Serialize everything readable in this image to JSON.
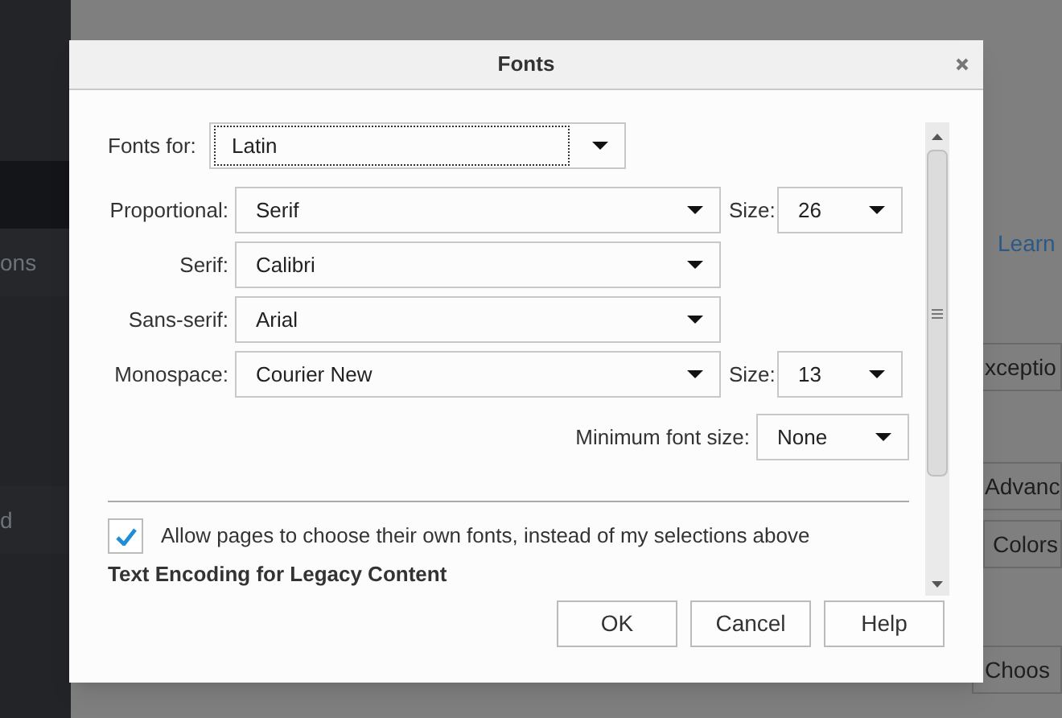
{
  "background": {
    "sidebar": {
      "items": [
        {
          "selected": true
        },
        {
          "label": "ons",
          "selected": false
        },
        {
          "label": "d",
          "selected": false
        }
      ]
    },
    "page": {
      "link": "Learn",
      "buttons": [
        "xceptio",
        "Advanc",
        "Colors",
        "Choos"
      ]
    }
  },
  "dialog": {
    "title": "Fonts",
    "fonts_for": {
      "label": "Fonts for:",
      "value": "Latin",
      "focused": true
    },
    "rows": [
      {
        "label": "Proportional:",
        "value": "Serif",
        "size": {
          "label": "Size:",
          "value": "26"
        }
      },
      {
        "label": "Serif:",
        "value": "Calibri"
      },
      {
        "label": "Sans-serif:",
        "value": "Arial"
      },
      {
        "label": "Monospace:",
        "value": "Courier New",
        "size": {
          "label": "Size:",
          "value": "13"
        }
      }
    ],
    "minimum": {
      "label": "Minimum font size:",
      "value": "None"
    },
    "allow": {
      "label": "Allow pages to choose their own fonts, instead of my selections above",
      "checked": true
    },
    "section_heading": "Text Encoding for Legacy Content",
    "buttons": [
      "OK",
      "Cancel",
      "Help"
    ]
  }
}
